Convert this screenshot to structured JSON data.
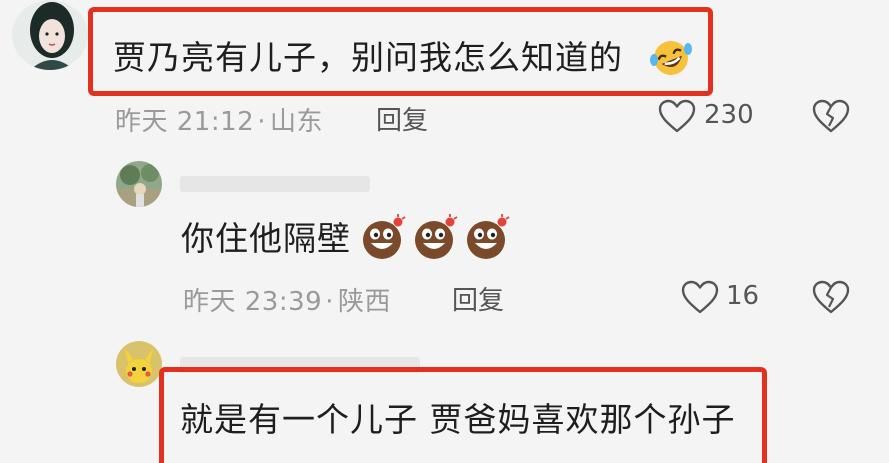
{
  "comments": [
    {
      "text": "贾乃亮有儿子，别问我怎么知道的",
      "time": "昨天 21:12",
      "location": "山东",
      "reply_label": "回复",
      "likes": "230",
      "emoji": "rolling-laughing-emoji"
    },
    {
      "text": "你住他隔壁",
      "time": "昨天 23:39",
      "location": "陕西",
      "reply_label": "回复",
      "likes": "16",
      "emoji": "grinning-brown-emoji"
    },
    {
      "text": "就是有一个儿子 贾爸妈喜欢那个孙子"
    }
  ],
  "colors": {
    "highlight": "#e2321f",
    "background": "#f4f4f4"
  },
  "separator": "·"
}
